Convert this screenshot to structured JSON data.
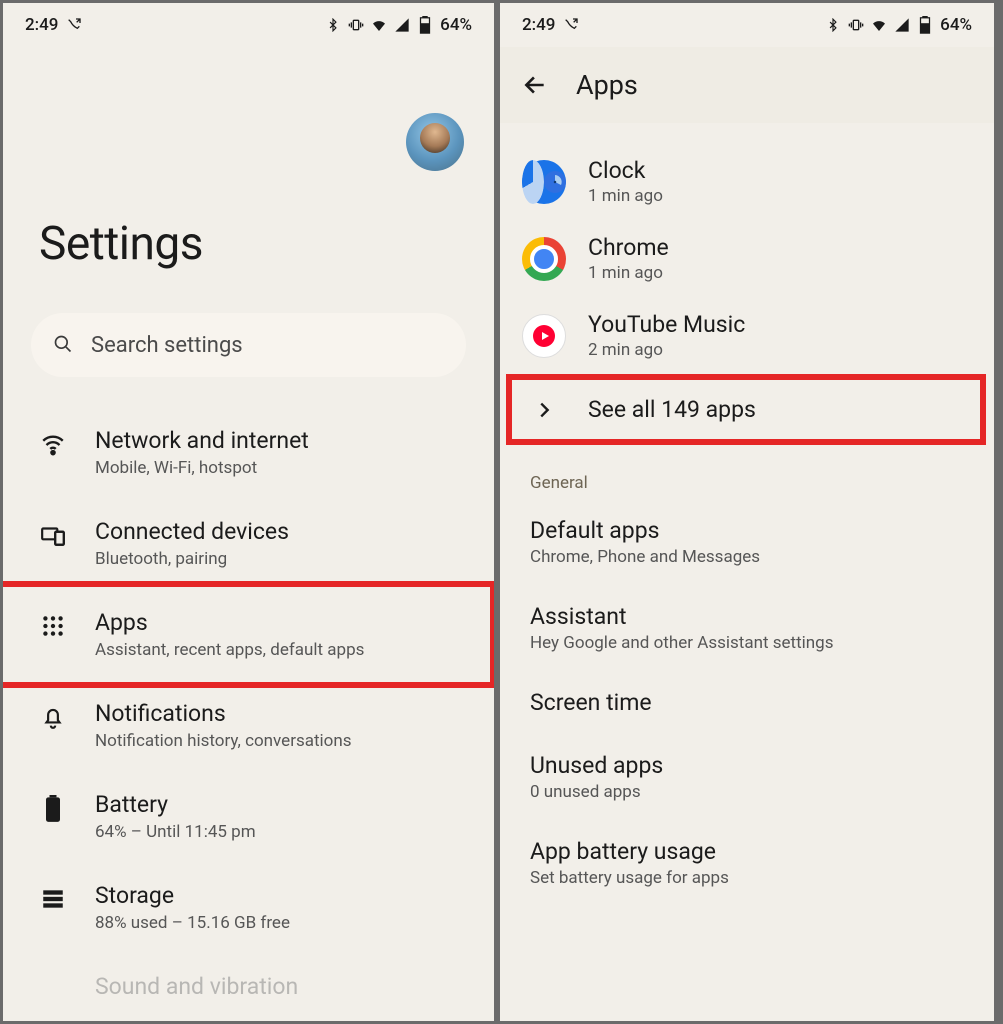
{
  "status": {
    "time": "2:49",
    "battery": "64%"
  },
  "left": {
    "title": "Settings",
    "search_placeholder": "Search settings",
    "items": [
      {
        "title": "Network and internet",
        "sub": "Mobile, Wi-Fi, hotspot",
        "icon": "wifi-icon"
      },
      {
        "title": "Connected devices",
        "sub": "Bluetooth, pairing",
        "icon": "devices-icon"
      },
      {
        "title": "Apps",
        "sub": "Assistant, recent apps, default apps",
        "icon": "apps-grid-icon",
        "highlight": true
      },
      {
        "title": "Notifications",
        "sub": "Notification history, conversations",
        "icon": "bell-icon"
      },
      {
        "title": "Battery",
        "sub": "64% – Until 11:45 pm",
        "icon": "battery-icon"
      },
      {
        "title": "Storage",
        "sub": "88% used – 15.16 GB free",
        "icon": "storage-icon"
      },
      {
        "title": "Sound and vibration",
        "sub": "",
        "icon": "sound-icon"
      }
    ]
  },
  "right": {
    "header": "Apps",
    "recent": [
      {
        "title": "Clock",
        "sub": "1 min ago",
        "icon": "clock"
      },
      {
        "title": "Chrome",
        "sub": "1 min ago",
        "icon": "chrome"
      },
      {
        "title": "YouTube Music",
        "sub": "2 min ago",
        "icon": "yt"
      }
    ],
    "see_all": "See all 149 apps",
    "general_label": "General",
    "general": [
      {
        "title": "Default apps",
        "sub": "Chrome, Phone and Messages"
      },
      {
        "title": "Assistant",
        "sub": "Hey Google and other Assistant settings"
      },
      {
        "title": "Screen time",
        "sub": ""
      },
      {
        "title": "Unused apps",
        "sub": "0 unused apps"
      },
      {
        "title": "App battery usage",
        "sub": "Set battery usage for apps"
      }
    ]
  }
}
